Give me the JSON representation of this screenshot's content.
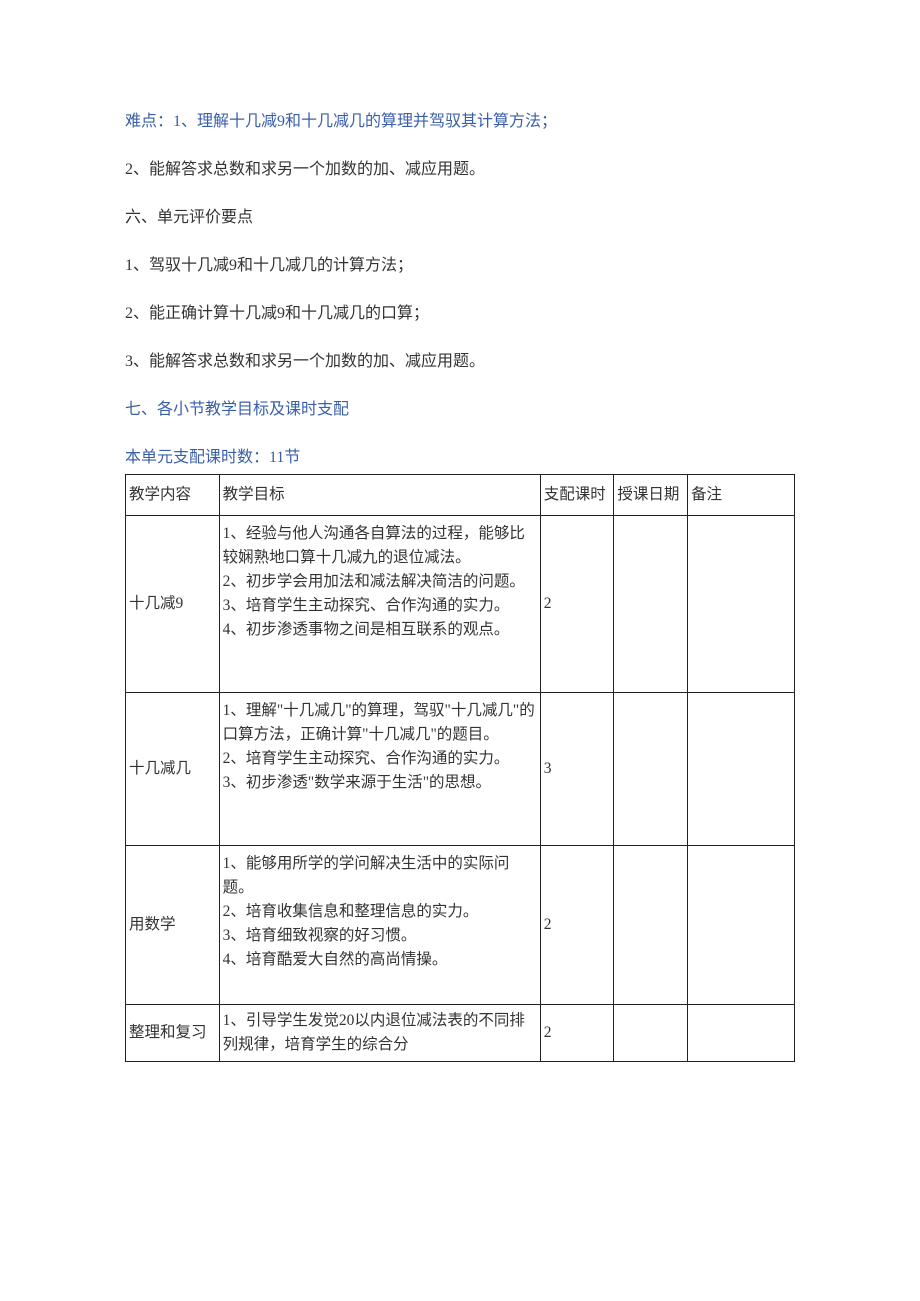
{
  "paragraphs": [
    {
      "text": "难点：1、理解十几减9和十几减几的算理并驾驭其计算方法；",
      "class": "blue"
    },
    {
      "text": "2、能解答求总数和求另一个加数的加、减应用题。",
      "class": ""
    },
    {
      "text": "六、单元评价要点",
      "class": ""
    },
    {
      "text": "1、驾驭十几减9和十几减几的计算方法；",
      "class": ""
    },
    {
      "text": "2、能正确计算十几减9和十几减几的口算；",
      "class": ""
    },
    {
      "text": "3、能解答求总数和求另一个加数的加、减应用题。",
      "class": ""
    },
    {
      "text": "七、各小节教学目标及课时支配",
      "class": "blue"
    },
    {
      "text": "本单元支配课时数：11节",
      "class": "blue"
    }
  ],
  "table": {
    "headers": [
      "教学内容",
      "教学目标",
      "支配课时",
      "授课日期",
      "备注"
    ],
    "rows": [
      {
        "c1": "十几减9",
        "c2": "1、经验与他人沟通各自算法的过程，能够比较娴熟地口算十几减九的退位减法。\n2、初步学会用加法和减法解决简洁的问题。\n3、培育学生主动探究、合作沟通的实力。\n4、初步渗透事物之间是相互联系的观点。",
        "c3": "2",
        "c4": "",
        "c5": "",
        "cls": "tall"
      },
      {
        "c1": "十几减几",
        "c2": "1、理解\"十几减几\"的算理，驾驭\"十几减几\"的口算方法，正确计算\"十几减几\"的题目。\n2、培育学生主动探究、合作沟通的实力。\n3、初步渗透\"数学来源于生活\"的思想。",
        "c3": "3",
        "c4": "",
        "c5": "",
        "cls": "tall"
      },
      {
        "c1": "用数学",
        "c2": "1、能够用所学的学问解决生活中的实际问题。\n2、培育收集信息和整理信息的实力。\n3、培育细致视察的好习惯。\n4、培育酷爱大自然的高尚情操。",
        "c3": "2",
        "c4": "",
        "c5": "",
        "cls": "mid"
      },
      {
        "c1": "整理和复习",
        "c2": "1、引导学生发觉20以内退位减法表的不同排列规律，培育学生的综合分",
        "c3": "2",
        "c4": "",
        "c5": "",
        "cls": ""
      }
    ]
  }
}
